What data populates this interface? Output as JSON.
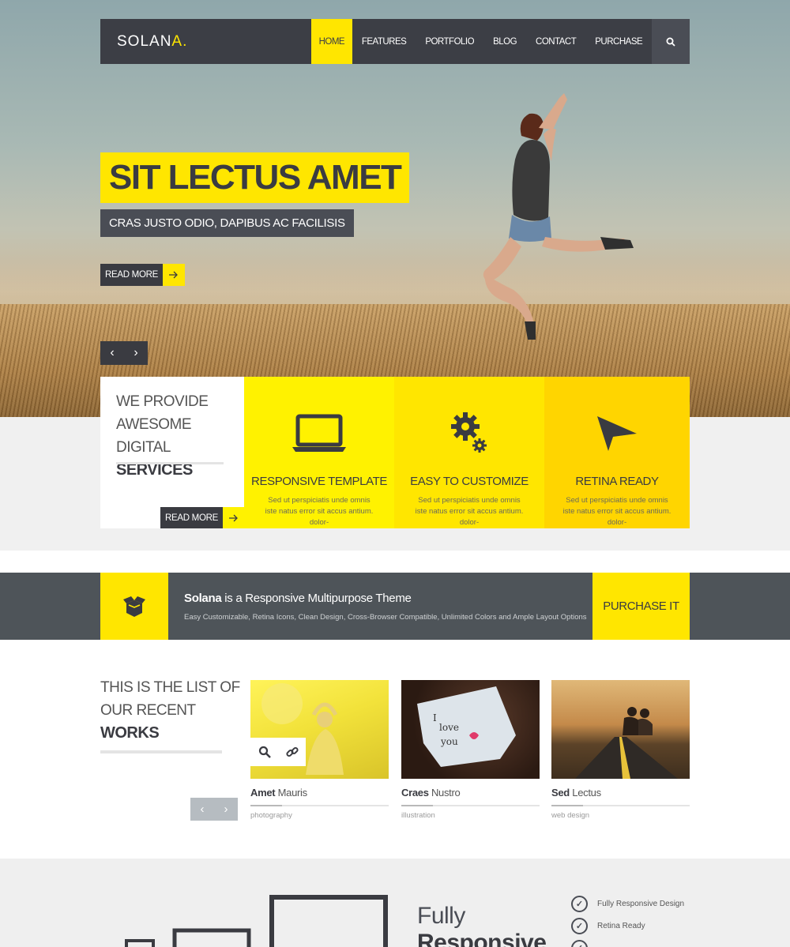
{
  "nav": {
    "logo_main": "SOLAN",
    "logo_accent": "A.",
    "items": [
      "HOME",
      "FEATURES",
      "PORTFOLIO",
      "BLOG",
      "CONTACT",
      "PURCHASE"
    ],
    "search_icon": "search-icon"
  },
  "hero": {
    "title": "SIT LECTUS AMET",
    "subtitle": "CRAS JUSTO ODIO, DAPIBUS AC FACILISIS",
    "read_more": "READ MORE",
    "prev": "‹",
    "next": "›"
  },
  "services": {
    "intro_line1": "WE PROVIDE",
    "intro_line2": "AWESOME DIGITAL",
    "intro_line3": "SERVICES",
    "read_more": "READ MORE",
    "items": [
      {
        "title": "RESPONSIVE TEMPLATE",
        "text": "Sed ut perspiciatis unde omnis iste natus error sit  accus  antium. dolor-",
        "icon": "laptop-icon"
      },
      {
        "title": "EASY TO CUSTOMIZE",
        "text": "Sed ut perspiciatis unde omnis iste natus error sit  accus  antium. dolor-",
        "icon": "gears-icon"
      },
      {
        "title": "RETINA READY",
        "text": "Sed ut perspiciatis unde omnis iste natus error sit  accus  antium. dolor-",
        "icon": "paper-plane-icon"
      }
    ],
    "colors": [
      "#fff200",
      "#ffe600",
      "#ffd500"
    ]
  },
  "purchase_bar": {
    "brand": "Solana",
    "headline": " is a Responsive Multipurpose Theme",
    "sub": "Easy Customizable, Retina Icons, Clean Design, Cross-Browser Compatible, Unlimited Colors and Ample Layout Options",
    "button": "PURCHASE IT",
    "icon": "box-icon"
  },
  "works": {
    "intro_line1": "THIS IS THE LIST OF",
    "intro_line2": "OUR RECENT",
    "intro_line3": "WORKS",
    "items": [
      {
        "bold": "Amet",
        "rest": " Mauris",
        "category": "photography"
      },
      {
        "bold": "Craes",
        "rest": " Nustro",
        "category": "illustration"
      },
      {
        "bold": "Sed",
        "rest": " Lectus",
        "category": "web design"
      }
    ]
  },
  "responsive": {
    "title_line1": "Fully",
    "title_line2": "Responsive",
    "checks": [
      "Fully Responsive Design",
      "Retina Ready",
      "..."
    ]
  },
  "accent": "#ffe600"
}
